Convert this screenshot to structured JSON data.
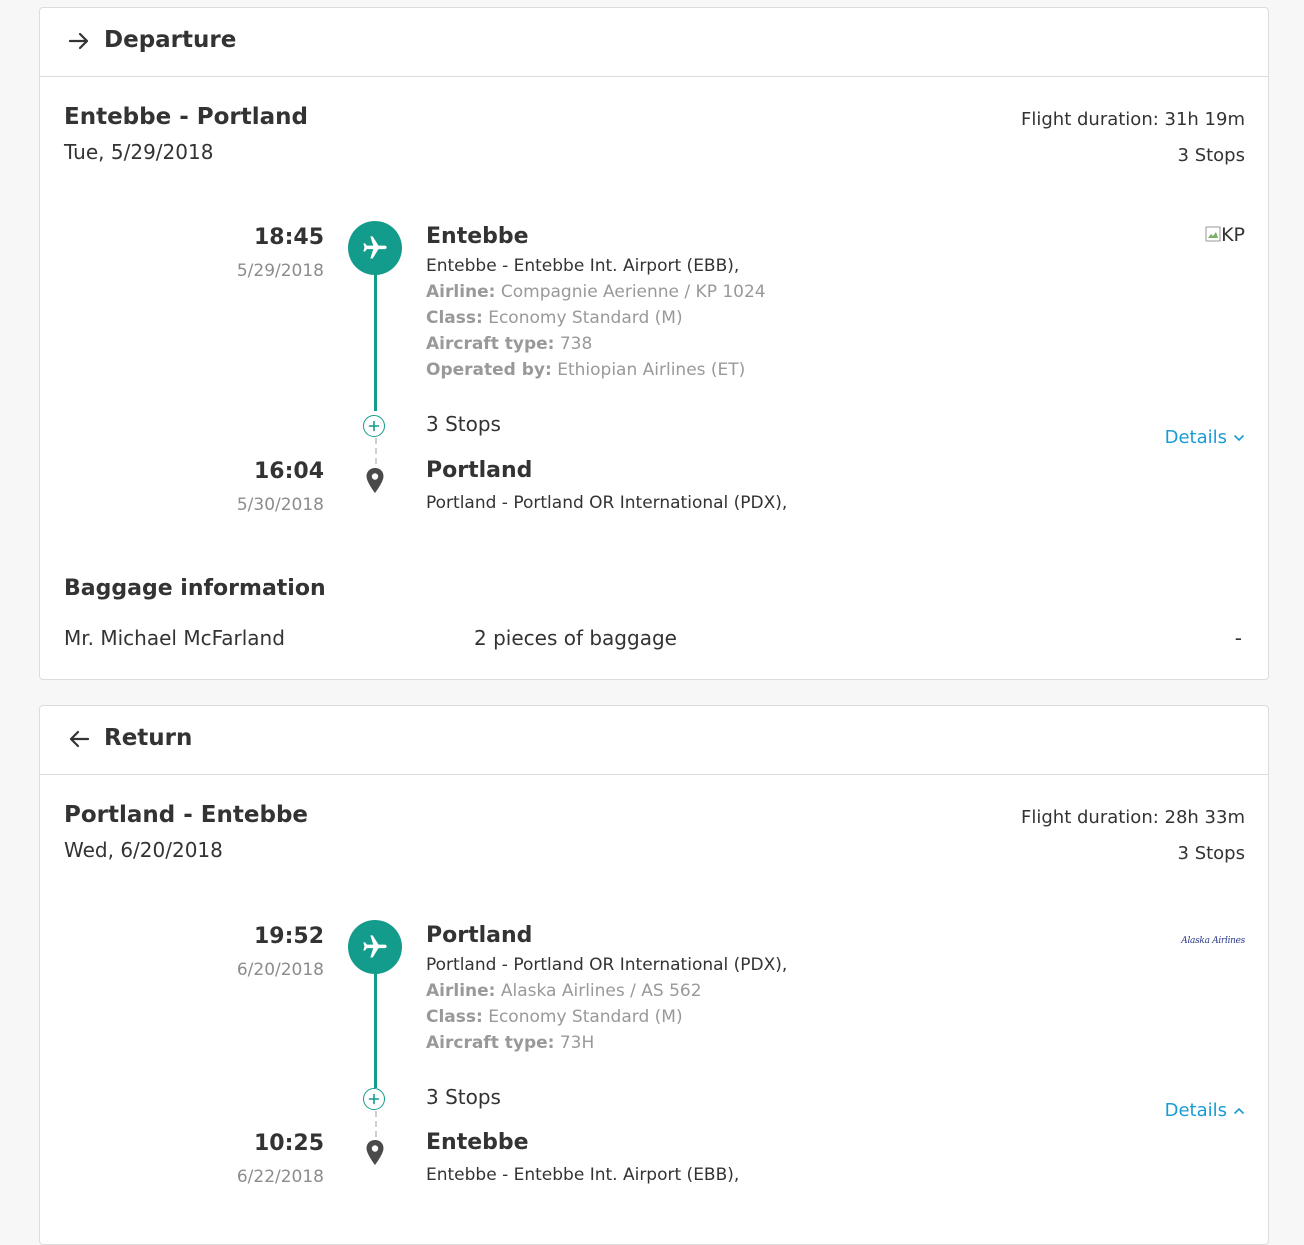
{
  "departure": {
    "header_title": "Departure",
    "route": "Entebbe - Portland",
    "date": "Tue, 5/29/2018",
    "flight_duration": "Flight duration: 31h 19m",
    "stops_summary": "3 Stops",
    "origin": {
      "time": "18:45",
      "date": "5/29/2018",
      "city": "Entebbe",
      "airport": "Entebbe - Entebbe Int. Airport (EBB),",
      "airline_label": "Airline:",
      "airline_value": "Compagnie Aerienne  / KP 1024",
      "class_label": "Class:",
      "class_value": "Economy Standard (M)",
      "aircraft_label": "Aircraft type:",
      "aircraft_value": "738",
      "operated_label": "Operated by:",
      "operated_value": "Ethiopian Airlines (ET)"
    },
    "airline_logo_alt": "KP",
    "stops_label": "3 Stops",
    "details_label": "Details",
    "destination": {
      "time": "16:04",
      "date": "5/30/2018",
      "city": "Portland",
      "airport": "Portland - Portland OR International (PDX),"
    },
    "baggage": {
      "title": "Baggage information",
      "passenger": "Mr. Michael McFarland",
      "pieces": "2 pieces of baggage",
      "extra": "-"
    }
  },
  "return": {
    "header_title": "Return",
    "route": "Portland - Entebbe",
    "date": "Wed, 6/20/2018",
    "flight_duration": "Flight duration: 28h 33m",
    "stops_summary": "3 Stops",
    "origin": {
      "time": "19:52",
      "date": "6/20/2018",
      "city": "Portland",
      "airport": "Portland - Portland OR International (PDX),",
      "airline_label": "Airline:",
      "airline_value": "Alaska Airlines / AS 562",
      "class_label": "Class:",
      "class_value": "Economy Standard (M)",
      "aircraft_label": "Aircraft type:",
      "aircraft_value": "73H"
    },
    "airline_logo_text": "Alaska Airlines",
    "stops_label": "3 Stops",
    "details_label": "Details",
    "destination": {
      "time": "10:25",
      "date": "6/22/2018",
      "city": "Entebbe",
      "airport": "Entebbe - Entebbe Int. Airport (EBB),"
    }
  },
  "colors": {
    "accent": "#139c8b",
    "link": "#1a9bd7",
    "muted": "#8c8c8c"
  }
}
